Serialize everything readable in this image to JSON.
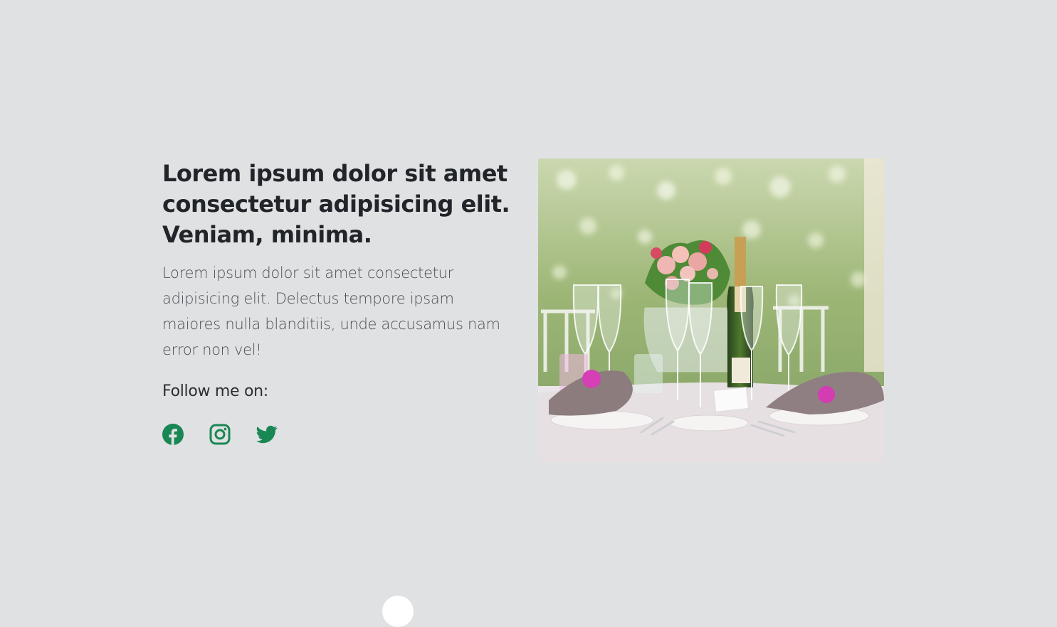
{
  "hero": {
    "headline": "Lorem ipsum dolor sit amet consectetur adipisicing elit. Veniam, minima.",
    "lead": "Lorem ipsum dolor sit amet consectetur adipisicing elit. Delectus tempore ipsam maiores nulla blanditiis, unde accusamus nam error non vel!",
    "follow_label": "Follow me on:",
    "social": [
      {
        "icon": "facebook-icon"
      },
      {
        "icon": "instagram-icon"
      },
      {
        "icon": "twitter-icon"
      }
    ],
    "image": {
      "subject": "wedding table setting"
    }
  },
  "colors": {
    "background": "#e0e1e3",
    "accent": "#198754",
    "text": "#212529"
  }
}
